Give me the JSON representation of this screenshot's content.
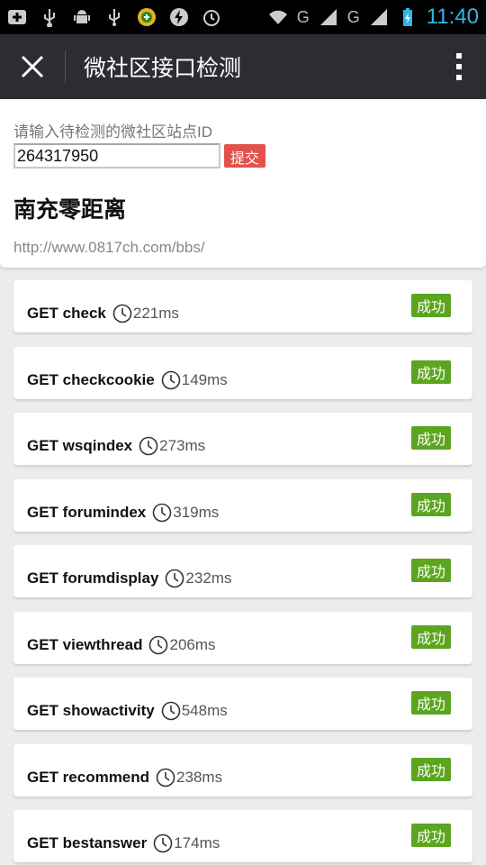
{
  "statusbar": {
    "g1": "G",
    "g2": "G",
    "time": "11:40"
  },
  "titlebar": {
    "title": "微社区接口检测"
  },
  "form": {
    "prompt": "请输入待检测的微社区站点ID",
    "site_id": "264317950",
    "submit_label": "提交"
  },
  "site": {
    "name": "南充零距离",
    "url": "http://www.0817ch.com/bbs/"
  },
  "requests": [
    {
      "label": "GET check",
      "duration": "221ms",
      "status": "成功"
    },
    {
      "label": "GET checkcookie",
      "duration": "149ms",
      "status": "成功"
    },
    {
      "label": "GET wsqindex",
      "duration": "273ms",
      "status": "成功"
    },
    {
      "label": "GET forumindex",
      "duration": "319ms",
      "status": "成功"
    },
    {
      "label": "GET forumdisplay",
      "duration": "232ms",
      "status": "成功"
    },
    {
      "label": "GET viewthread",
      "duration": "206ms",
      "status": "成功"
    },
    {
      "label": "GET showactivity",
      "duration": "548ms",
      "status": "成功"
    },
    {
      "label": "GET recommend",
      "duration": "238ms",
      "status": "成功"
    },
    {
      "label": "GET bestanswer",
      "duration": "174ms",
      "status": "成功"
    }
  ],
  "colors": {
    "success": "#5ca51f",
    "submit": "#e0524a",
    "titlebar": "#2b2d31",
    "clock": "#33b5e5"
  }
}
